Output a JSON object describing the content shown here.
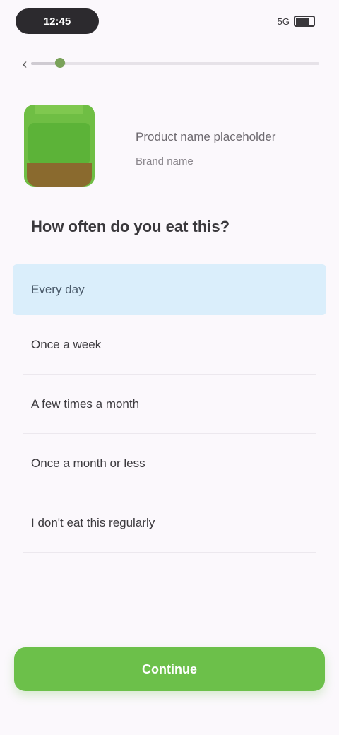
{
  "status_bar": {
    "time": "12:45",
    "signal": "5G",
    "battery_icon": "battery-icon"
  },
  "header": {
    "back_icon": "arrow-left-icon",
    "progress_fraction": 0.12
  },
  "product": {
    "image_icon": "product-jar-image",
    "name": "Product name placeholder",
    "subtitle": "Brand name"
  },
  "question": {
    "title": "How often do you eat this?"
  },
  "options": [
    {
      "label": "Every day",
      "selected": true
    },
    {
      "label": "Once a week",
      "selected": false
    },
    {
      "label": "A few times a month",
      "selected": false
    },
    {
      "label": "Once a month or less",
      "selected": false
    },
    {
      "label": "I don't eat this regularly",
      "selected": false
    }
  ],
  "footer": {
    "continue_label": "Continue"
  },
  "colors": {
    "accent_green": "#6cc04a",
    "selected_bg": "#daeefb",
    "background": "#fbf8fc"
  }
}
